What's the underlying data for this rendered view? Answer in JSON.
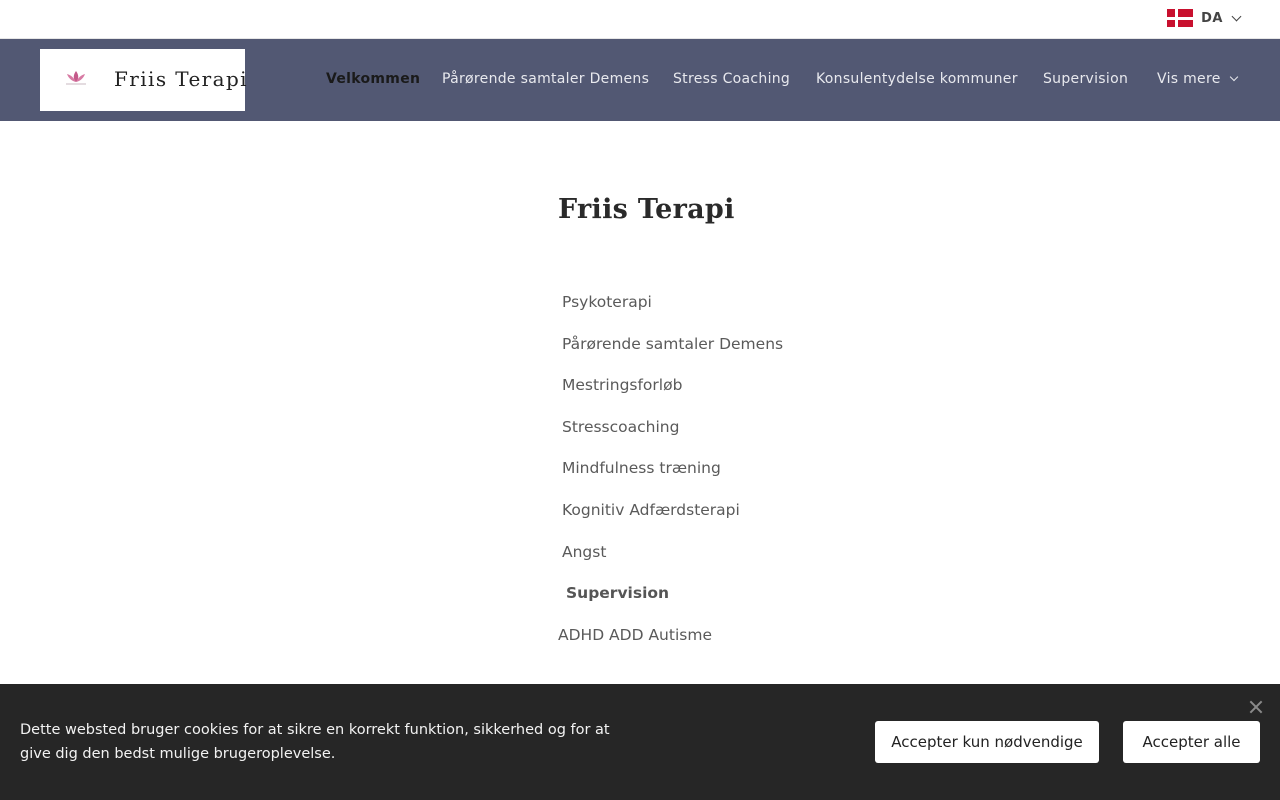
{
  "language": {
    "code": "DA",
    "flag_icon": "denmark-flag-icon"
  },
  "brand": {
    "name": "Friis Terapi",
    "logo_icon": "lotus-icon",
    "logo_color": "#c45a8a"
  },
  "colors": {
    "navbar_bg": "#525873",
    "cookie_bg": "#262626",
    "flag_red": "#c8102e"
  },
  "nav": {
    "items": [
      {
        "label": "Velkommen",
        "active": true
      },
      {
        "label": "Pårørende samtaler Demens"
      },
      {
        "label": "Stress Coaching"
      },
      {
        "label": "Konsulentydelse kommuner"
      },
      {
        "label": "Supervision"
      }
    ],
    "more_label": "Vis mere"
  },
  "main": {
    "title": "Friis Terapi",
    "services": [
      "Psykoterapi",
      "Pårørende samtaler Demens",
      "Mestringsforløb",
      "Stresscoaching",
      "Mindfulness træning",
      "Kognitiv Adfærdsterapi",
      "Angst",
      "Supervision",
      "ADHD ADD Autisme"
    ]
  },
  "cookie": {
    "text": "Dette websted bruger cookies for at sikre en korrekt funktion, sikkerhed og for at give dig den bedst mulige brugeroplevelse.",
    "btn_necessary": "Accepter kun nødvendige",
    "btn_all": "Accepter alle"
  }
}
